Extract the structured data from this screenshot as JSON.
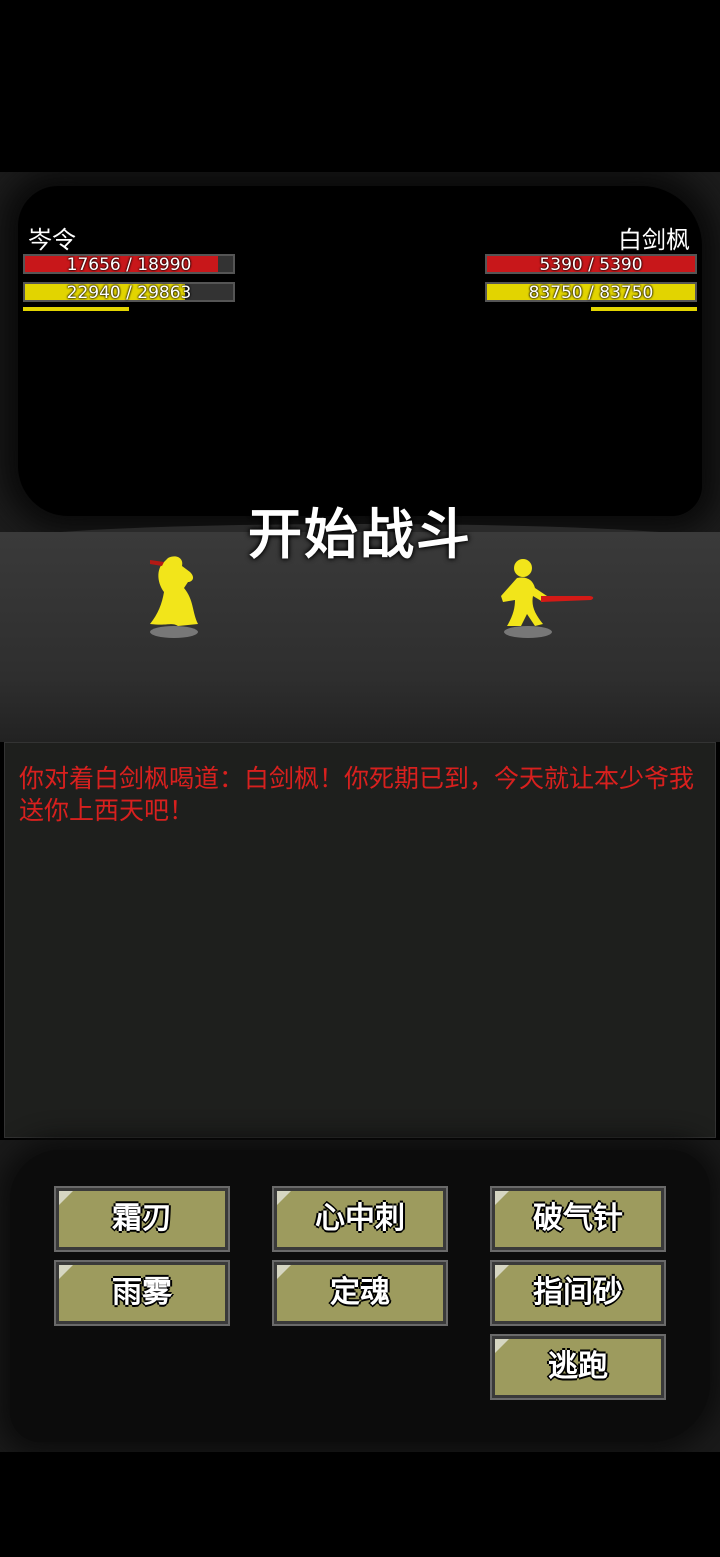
{
  "player": {
    "name": "岑令",
    "hp_text": "17656 / 18990",
    "hp_fraction": 0.93,
    "mp_text": "22940 / 29863",
    "mp_fraction": 0.77
  },
  "enemy": {
    "name": "白剑枫",
    "hp_text": "5390 / 5390",
    "hp_fraction": 1.0,
    "mp_text": "83750 / 83750",
    "mp_fraction": 1.0
  },
  "banner": "开始战斗",
  "log": {
    "message": "你对着白剑枫喝道：白剑枫！你死期已到，今天就让本少爷我送你上西天吧！"
  },
  "skills": [
    "霜刃",
    "心中刺",
    "破气针",
    "雨雾",
    "定魂",
    "指间砂"
  ],
  "flee_label": "逃跑",
  "colors": {
    "hp": "#c8171a",
    "mp": "#e2d400",
    "log_text": "#d8201e",
    "button": "#9d9b5e"
  }
}
